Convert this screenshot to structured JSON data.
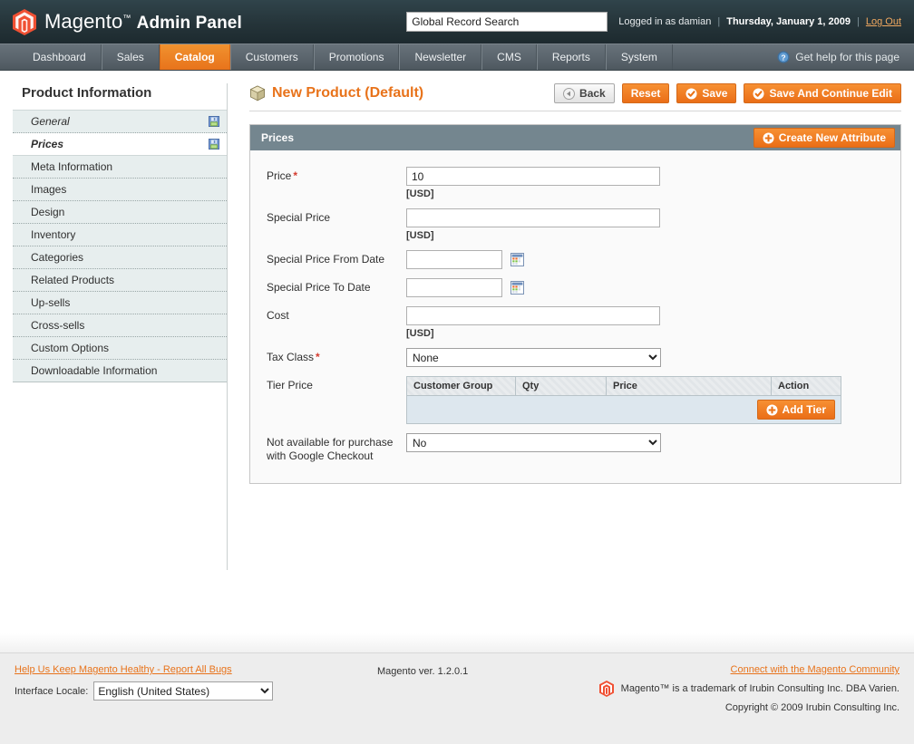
{
  "header": {
    "brand_main": "Magento",
    "brand_tm": "™",
    "brand_sub": "Admin Panel",
    "search_value": "Global Record Search",
    "logged_in_as": "Logged in as damian",
    "separator": "|",
    "date": "Thursday, January 1, 2009",
    "logout_label": "Log Out",
    "logo_color": "#f05033"
  },
  "nav": {
    "items": [
      {
        "label": "Dashboard",
        "active": false
      },
      {
        "label": "Sales",
        "active": false
      },
      {
        "label": "Catalog",
        "active": true
      },
      {
        "label": "Customers",
        "active": false
      },
      {
        "label": "Promotions",
        "active": false
      },
      {
        "label": "Newsletter",
        "active": false
      },
      {
        "label": "CMS",
        "active": false
      },
      {
        "label": "Reports",
        "active": false
      },
      {
        "label": "System",
        "active": false
      }
    ],
    "help_label": "Get help for this page",
    "active_color": "#e8731b"
  },
  "sidebar": {
    "title": "Product Information",
    "items": [
      {
        "label": "General",
        "state": "saved"
      },
      {
        "label": "Prices",
        "state": "current"
      },
      {
        "label": "Meta Information",
        "state": "plain"
      },
      {
        "label": "Images",
        "state": "plain"
      },
      {
        "label": "Design",
        "state": "plain"
      },
      {
        "label": "Inventory",
        "state": "plain"
      },
      {
        "label": "Categories",
        "state": "plain"
      },
      {
        "label": "Related Products",
        "state": "plain"
      },
      {
        "label": "Up-sells",
        "state": "plain"
      },
      {
        "label": "Cross-sells",
        "state": "plain"
      },
      {
        "label": "Custom Options",
        "state": "plain"
      },
      {
        "label": "Downloadable Information",
        "state": "plain"
      }
    ]
  },
  "page": {
    "title": "New Product (Default)",
    "title_color": "#e8731b",
    "buttons": {
      "back": "Back",
      "reset": "Reset",
      "save": "Save",
      "save_continue": "Save And Continue Edit"
    }
  },
  "panel": {
    "title": "Prices",
    "create_attribute": "Create New Attribute"
  },
  "form": {
    "price_label": "Price",
    "price_value": "10",
    "price_note": "[USD]",
    "special_price_label": "Special Price",
    "special_price_value": "",
    "special_price_note": "[USD]",
    "special_from_label": "Special Price From Date",
    "special_from_value": "",
    "special_to_label": "Special Price To Date",
    "special_to_value": "",
    "cost_label": "Cost",
    "cost_value": "",
    "cost_note": "[USD]",
    "tax_class_label": "Tax Class",
    "tax_class_value": "None",
    "tier_price_label": "Tier Price",
    "google_label_line1": "Not available for purchase",
    "google_label_line2": "with Google Checkout",
    "google_value": "No",
    "required_marker": "*"
  },
  "tier_table": {
    "columns": [
      "Customer Group",
      "Qty",
      "Price",
      "Action"
    ],
    "rows": [],
    "add_button": "Add Tier"
  },
  "footer": {
    "report_bugs": "Help Us Keep Magento Healthy - Report All Bugs",
    "locale_label": "Interface Locale:",
    "locale_value": "English (United States)",
    "version": "Magento ver. 1.2.0.1",
    "community_link": "Connect with the Magento Community",
    "trademark": "Magento™ is a trademark of Irubin Consulting Inc. DBA Varien.",
    "copyright": "Copyright © 2009 Irubin Consulting Inc."
  }
}
